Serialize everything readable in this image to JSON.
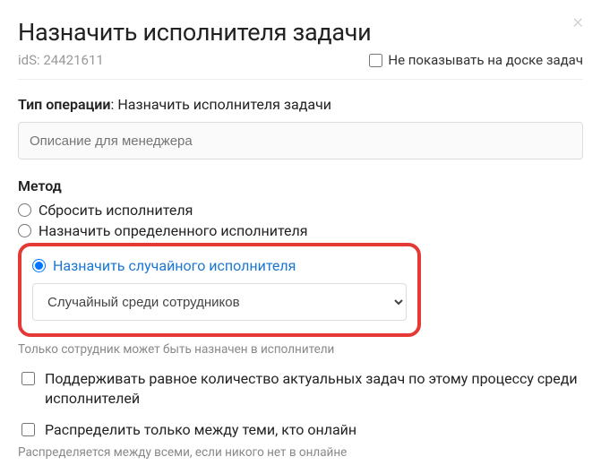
{
  "dialog": {
    "title": "Назначить исполнителя задачи",
    "ids": "idS: 24421611",
    "hide_on_board_label": "Не показывать на доске задач"
  },
  "operation": {
    "type_label": "Тип операции",
    "type_value": "Назначить исполнителя задачи",
    "description_placeholder": "Описание для менеджера"
  },
  "method": {
    "heading": "Метод",
    "options": {
      "reset": "Сбросить исполнителя",
      "assign_specific": "Назначить определенного исполнителя",
      "assign_random": "Назначить случайного исполнителя"
    },
    "random_select_value": "Случайный среди сотрудников",
    "hint_only_employee": "Только сотрудник может быть назначен в исполнители",
    "keep_equal_label": "Поддерживать равное количество актуальных задач по этому процессу среди исполнителей",
    "online_only_label": "Распределить только между теми, кто онлайн",
    "hint_everyone_if_none": "Распределяется между всеми, если никого нет в онлайне"
  }
}
